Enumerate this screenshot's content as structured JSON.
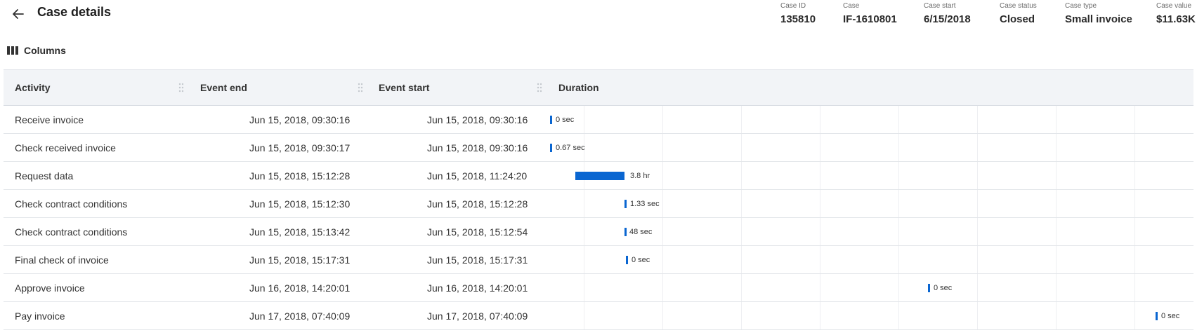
{
  "header": {
    "title": "Case details",
    "meta": [
      {
        "label": "Case ID",
        "value": "135810"
      },
      {
        "label": "Case",
        "value": "IF-1610801"
      },
      {
        "label": "Case start",
        "value": "6/15/2018"
      },
      {
        "label": "Case status",
        "value": "Closed"
      },
      {
        "label": "Case type",
        "value": "Small invoice"
      },
      {
        "label": "Case value",
        "value": "$11.63K"
      }
    ]
  },
  "toolbar": {
    "columns_label": "Columns"
  },
  "table": {
    "headers": {
      "activity": "Activity",
      "event_end": "Event end",
      "event_start": "Event start",
      "duration": "Duration"
    },
    "rows": [
      {
        "activity": "Receive invoice",
        "event_end": "Jun 15, 2018, 09:30:16",
        "event_start": "Jun 15, 2018, 09:30:16",
        "duration": "0 sec"
      },
      {
        "activity": "Check received invoice",
        "event_end": "Jun 15, 2018, 09:30:17",
        "event_start": "Jun 15, 2018, 09:30:16",
        "duration": "0.67 sec"
      },
      {
        "activity": "Request data",
        "event_end": "Jun 15, 2018, 15:12:28",
        "event_start": "Jun 15, 2018, 11:24:20",
        "duration": "3.8 hr"
      },
      {
        "activity": "Check contract conditions",
        "event_end": "Jun 15, 2018, 15:12:30",
        "event_start": "Jun 15, 2018, 15:12:28",
        "duration": "1.33 sec"
      },
      {
        "activity": "Check contract conditions",
        "event_end": "Jun 15, 2018, 15:13:42",
        "event_start": "Jun 15, 2018, 15:12:54",
        "duration": "48 sec"
      },
      {
        "activity": "Final check of invoice",
        "event_end": "Jun 15, 2018, 15:17:31",
        "event_start": "Jun 15, 2018, 15:17:31",
        "duration": "0 sec"
      },
      {
        "activity": "Approve invoice",
        "event_end": "Jun 16, 2018, 14:20:01",
        "event_start": "Jun 16, 2018, 14:20:01",
        "duration": "0 sec"
      },
      {
        "activity": "Pay invoice",
        "event_end": "Jun 17, 2018, 07:40:09",
        "event_start": "Jun 17, 2018, 07:40:09",
        "duration": "0 sec"
      }
    ]
  },
  "colors": {
    "bar": "#0a66d1",
    "header_bg": "#f2f4f7"
  }
}
